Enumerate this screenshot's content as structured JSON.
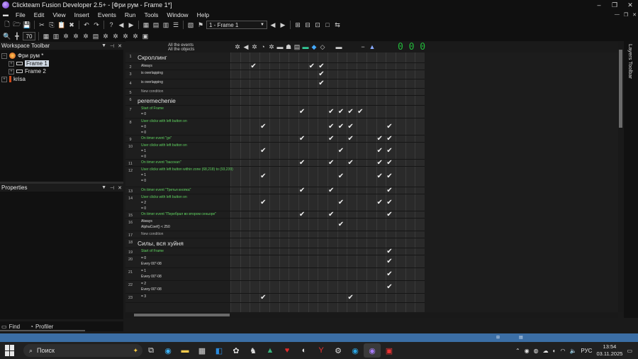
{
  "window": {
    "title": "Clickteam Fusion Developer 2.5+ - [Фри рум - Frame 1*]",
    "controls": [
      "–",
      "❐",
      "✕"
    ]
  },
  "menu": [
    "File",
    "Edit",
    "View",
    "Insert",
    "Events",
    "Run",
    "Tools",
    "Window",
    "Help"
  ],
  "toolbar": {
    "zoom": "70",
    "frame_select": "1 - Frame 1"
  },
  "workspace": {
    "title": "Workspace Toolbar",
    "tree": [
      {
        "label": "Фри рум *",
        "level": 0
      },
      {
        "label": "Frame 1",
        "level": 1,
        "selected": true
      },
      {
        "label": "Frame 2",
        "level": 1
      },
      {
        "label": "krisa",
        "level": 0
      }
    ]
  },
  "properties": {
    "title": "Properties"
  },
  "bottom_tabs": [
    "Find",
    "Profiler"
  ],
  "editor": {
    "header_all_events": "All the events",
    "header_all_objects": "All the objects",
    "counter": "0  0  0",
    "rows": [
      {
        "num": "1",
        "type": "group",
        "text": "Скроллинг"
      },
      {
        "num": "2",
        "type": "cond",
        "lines": [
          "Always"
        ]
      },
      {
        "num": "3",
        "type": "cond",
        "lines": [
          "is overlapping"
        ]
      },
      {
        "num": "4",
        "type": "cond",
        "lines": [
          "is overlapping"
        ]
      },
      {
        "num": "5",
        "type": "new",
        "lines": [
          "New condition"
        ]
      },
      {
        "num": "6",
        "type": "group",
        "text": "peremechenie"
      },
      {
        "num": "7",
        "type": "cond",
        "lines": [
          "Start of Frame",
          "= 0"
        ]
      },
      {
        "num": "8",
        "type": "cond",
        "lines": [
          "User clicks with left button on",
          "= 0",
          "= 0"
        ]
      },
      {
        "num": "9",
        "type": "cond",
        "lines": [
          "On timer event \"go\""
        ]
      },
      {
        "num": "10",
        "type": "cond",
        "lines": [
          "User clicks with left button on",
          "= 1",
          "= 0"
        ]
      },
      {
        "num": "11",
        "type": "cond",
        "lines": [
          "On timer event \"bacovan\""
        ]
      },
      {
        "num": "12",
        "type": "cond",
        "lines": [
          "User clicks with left button within zone (68,218) to (93,239)",
          "= 1",
          "= 0"
        ]
      },
      {
        "num": "13",
        "type": "cond",
        "lines": [
          "On timer event \"Третья кнопка\""
        ]
      },
      {
        "num": "14",
        "type": "cond",
        "lines": [
          "User clicks with left button on",
          "= 2",
          "= 0"
        ]
      },
      {
        "num": "15",
        "type": "cond",
        "lines": [
          "On timer event \"Перебрал во втором сеньоре\""
        ]
      },
      {
        "num": "16",
        "type": "cond",
        "lines": [
          "Always",
          "AlphaCoef() < 250"
        ]
      },
      {
        "num": "17",
        "type": "new",
        "lines": [
          "New condition"
        ]
      },
      {
        "num": "18",
        "type": "group",
        "text": "Силы, вся хуйня"
      },
      {
        "num": "19",
        "type": "cond",
        "lines": [
          "Start of Frame"
        ]
      },
      {
        "num": "20",
        "type": "cond",
        "lines": [
          "= 0",
          "Every 00\"-08"
        ]
      },
      {
        "num": "21",
        "type": "cond",
        "lines": [
          "= 1",
          "Every 00\"-08"
        ]
      },
      {
        "num": "22",
        "type": "cond",
        "lines": [
          "= 2",
          "Every 00\"-08"
        ]
      },
      {
        "num": "23",
        "type": "cond",
        "lines": [
          "= 3"
        ]
      }
    ]
  },
  "layers_toolbar": "Layers Toolbar",
  "statusbar": [
    "",
    "",
    ""
  ],
  "taskbar": {
    "search_placeholder": "Поиск",
    "lang": "РУС",
    "time": "13:54",
    "date": "03.11.2025"
  }
}
